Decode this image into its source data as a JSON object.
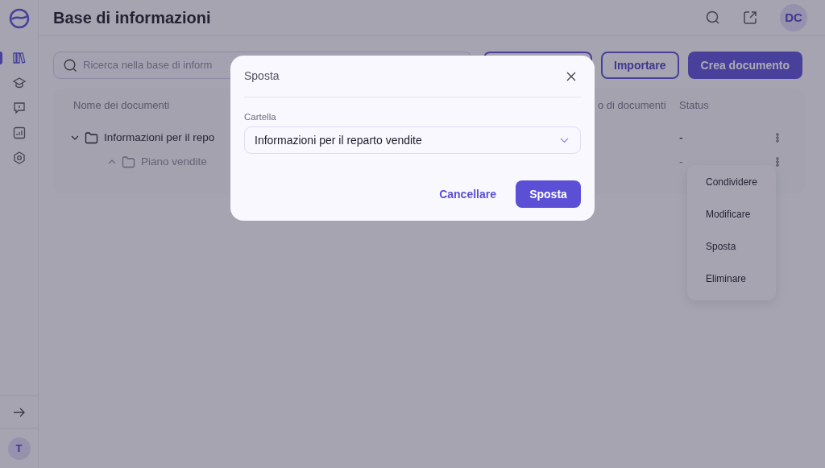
{
  "sidebar": {
    "items": [
      {
        "selected": true
      },
      {
        "selected": false
      },
      {
        "selected": false
      },
      {
        "selected": false
      },
      {
        "selected": false
      }
    ],
    "user_initial": "T"
  },
  "header": {
    "title": "Base di informazioni",
    "avatar": "DC"
  },
  "toolbar": {
    "search": {
      "placeholder": "Ricerca nella base di inform"
    },
    "buttons": [
      {
        "kind": "outline"
      },
      {
        "label": "Importare",
        "kind": "outline"
      },
      {
        "label": "Crea documento",
        "kind": "primary"
      }
    ]
  },
  "table": {
    "columns": [
      "Nome dei documenti",
      "o di documenti",
      "Status"
    ],
    "rows": [
      {
        "name": "Informazioni per il repo",
        "status": "-",
        "expanded": true,
        "children": [
          {
            "name": "Piano vendite",
            "status": "-",
            "expanded": false
          }
        ]
      }
    ]
  },
  "context_menu": [
    "Condividere",
    "Modificare",
    "Sposta",
    "Eliminare"
  ],
  "dialog": {
    "title": "Sposta",
    "field_label": "Cartella",
    "field_value": "Informazioni per il reparto vendite",
    "buttons": [
      {
        "label": "Cancellare",
        "kind": "text"
      },
      {
        "label": "Sposta",
        "kind": "primary"
      }
    ]
  }
}
